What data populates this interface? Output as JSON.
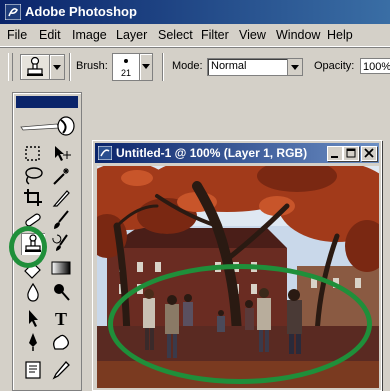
{
  "app": {
    "title": "Adobe Photoshop"
  },
  "menu": [
    "File",
    "Edit",
    "Image",
    "Layer",
    "Select",
    "Filter",
    "View",
    "Window",
    "Help"
  ],
  "options": {
    "brush_label": "Brush:",
    "brush_size": "21",
    "mode_label": "Mode:",
    "mode_value": "Normal",
    "opacity_label": "Opacity:",
    "opacity_value": "100%"
  },
  "document": {
    "title": "Untitled-1 @ 100% (Layer 1, RGB)"
  },
  "toolbox": {
    "tools": [
      "marquee-tool",
      "move-tool",
      "lasso-tool",
      "magic-wand-tool",
      "crop-tool",
      "slice-tool",
      "healing-brush-tool",
      "brush-tool",
      "clone-stamp-tool",
      "history-brush-tool",
      "eraser-tool",
      "gradient-tool",
      "blur-tool",
      "dodge-tool",
      "path-selection-tool",
      "type-tool",
      "pen-tool",
      "shape-tool",
      "notes-tool",
      "eyedropper-tool"
    ],
    "selected_tool": "clone-stamp-tool"
  },
  "annotations": {
    "highlight_color": "#1f8f3a"
  },
  "colors": {
    "title_bar": "#0a246a",
    "chrome": "#d4d0c8"
  }
}
